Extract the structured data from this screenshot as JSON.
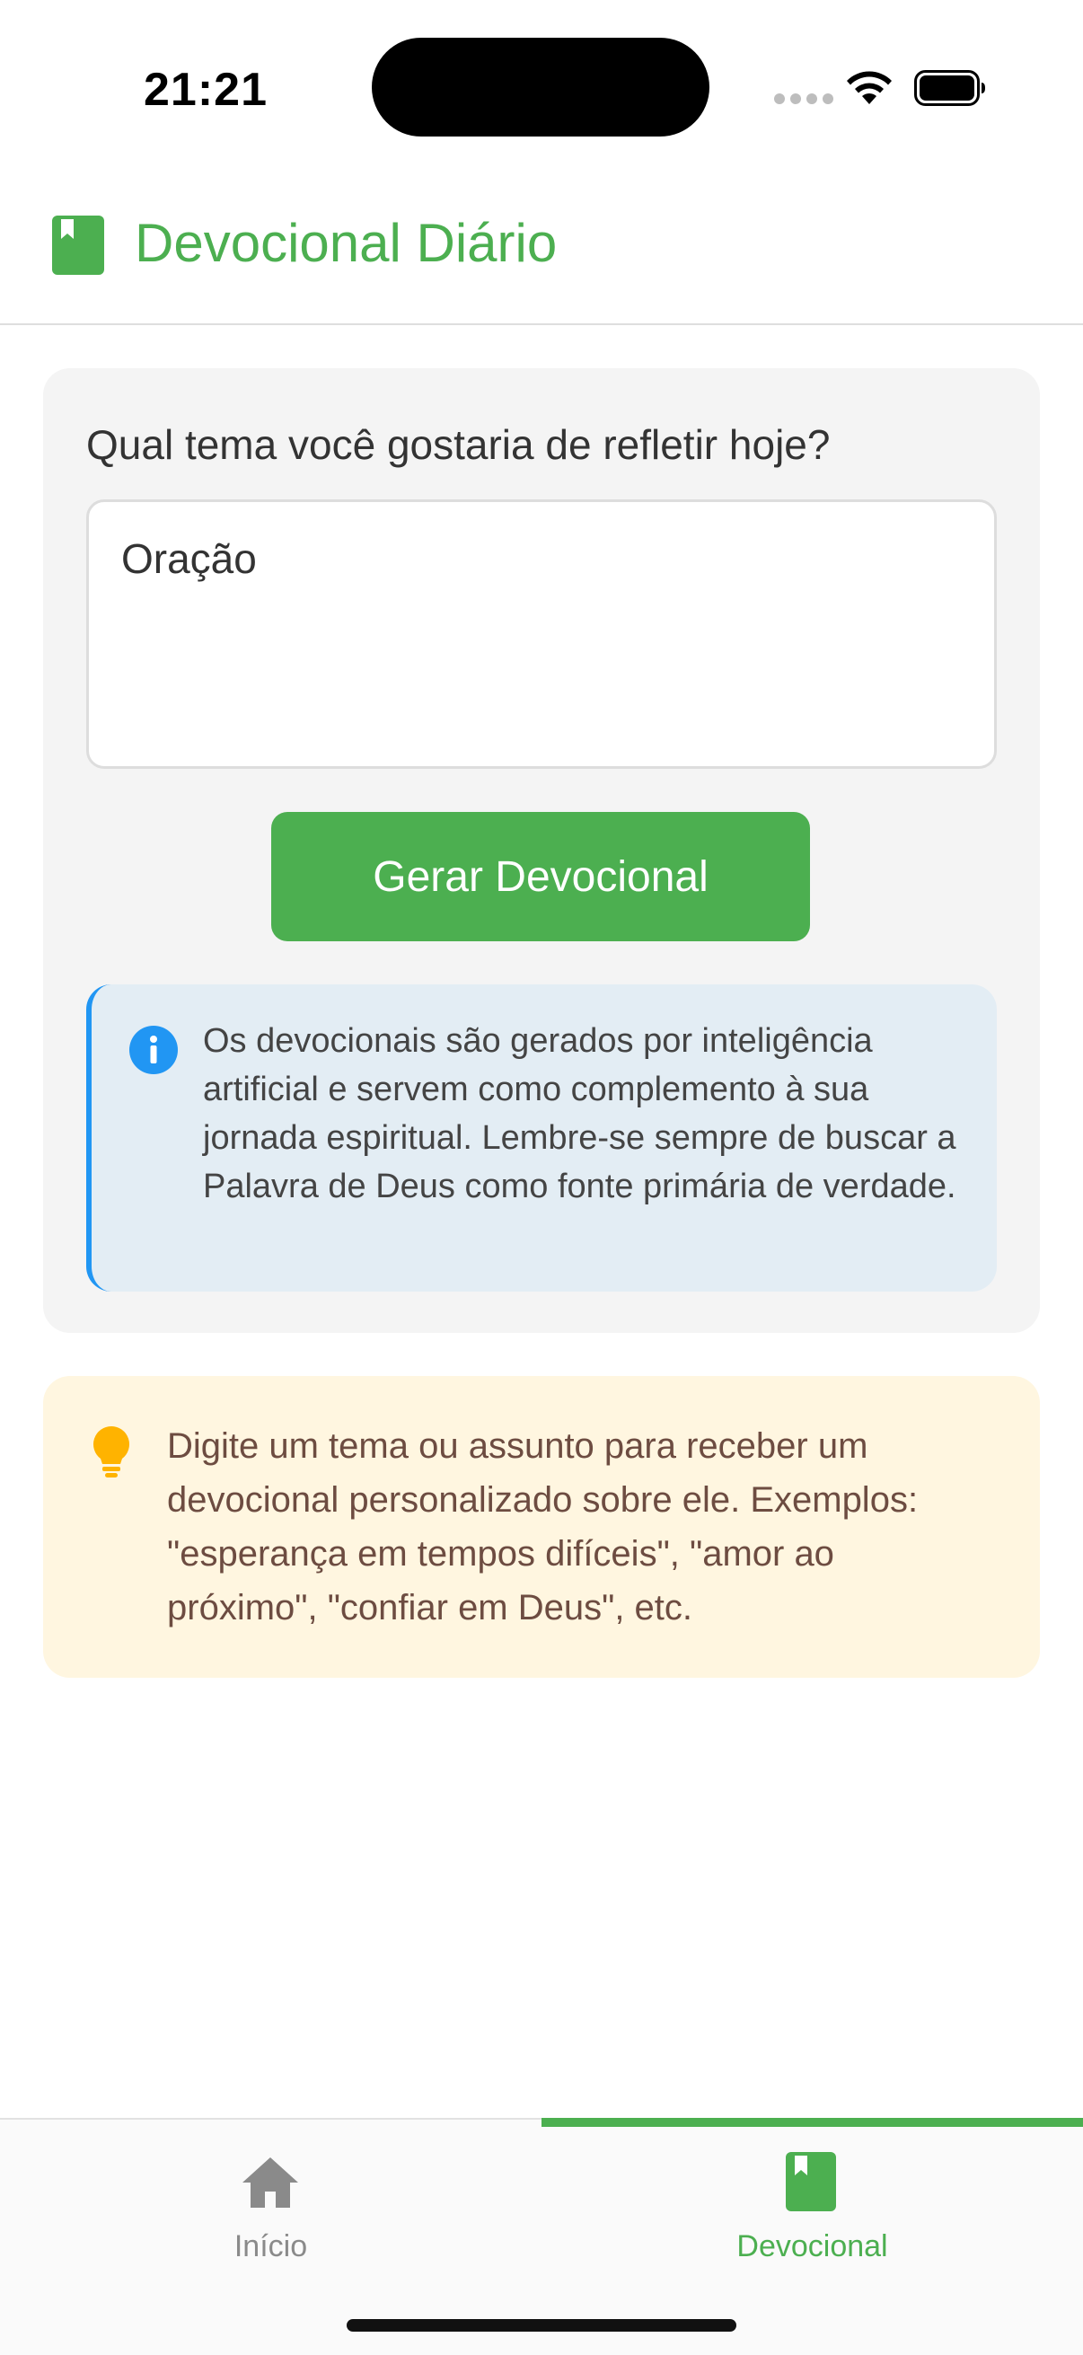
{
  "status_bar": {
    "time": "21:21",
    "icons": [
      "cellular-icon",
      "wifi-icon",
      "battery-icon"
    ]
  },
  "header": {
    "icon": "book-icon",
    "title": "Devocional Diário"
  },
  "form": {
    "question": "Qual tema você gostaria de refletir hoje?",
    "theme_value": "Oração",
    "generate_label": "Gerar Devocional"
  },
  "info": {
    "icon": "info-icon",
    "text": "Os devocionais são gerados por inteligência artificial e servem como complemento à sua jornada espiritual. Lembre-se sempre de buscar a Palavra de Deus como fonte primária de verdade."
  },
  "tip": {
    "icon": "lightbulb-icon",
    "text": "Digite um tema ou assunto para receber um devocional personalizado sobre ele. Exemplos: \"esperança em tempos difíceis\", \"amor ao próximo\", \"confiar em Deus\", etc."
  },
  "bottom_nav": {
    "items": [
      {
        "label": "Início",
        "icon": "home-icon",
        "active": false
      },
      {
        "label": "Devocional",
        "icon": "book-icon",
        "active": true
      }
    ]
  },
  "colors": {
    "accent": "#4caf50",
    "info_blue": "#2196f3",
    "info_bg": "#e3edf4",
    "tip_bg": "#fff6e0",
    "tip_icon": "#ffb300",
    "tip_text": "#6d4c41"
  }
}
